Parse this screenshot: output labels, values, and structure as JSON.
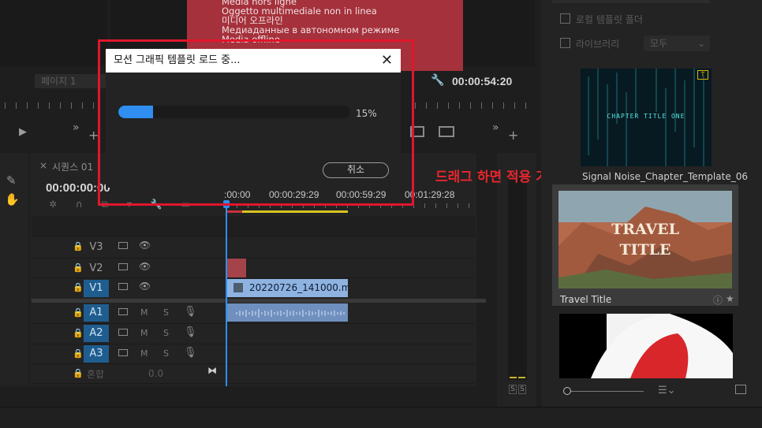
{
  "monitor": {
    "offline_lines": [
      "Média hors ligne",
      "Oggetto multimediale non in linea",
      "미디어 오프라인",
      "Медиаданные в автономном режиме",
      "Media offline"
    ],
    "page_label": "페이지 1",
    "duration_timecode": "00:00:54:20"
  },
  "dialog": {
    "title": "모션 그래픽 템플릿 로드 중...",
    "progress_percent": 15,
    "progress_text": "15%",
    "cancel_label": "취소"
  },
  "annotation": "드래그 하면 적용 가능",
  "timeline": {
    "sequence_tab": "시퀀스 01",
    "timecode": "00:00:00:00",
    "ruler_labels": [
      ":00:00",
      "00:00:29:29",
      "00:00:59:29",
      "00:01:29:28"
    ],
    "tracks": [
      {
        "id": "V3",
        "targeted": false
      },
      {
        "id": "V2",
        "targeted": false
      },
      {
        "id": "V1",
        "targeted": true
      },
      {
        "id": "A1",
        "targeted": true
      },
      {
        "id": "A2",
        "targeted": true
      },
      {
        "id": "A3",
        "targeted": true
      }
    ],
    "mix_label": "혼합",
    "mix_value": "0.0",
    "clip_name": "20220726_141000.m",
    "audio_m": "M",
    "audio_s": "S"
  },
  "meters": {
    "solo_left": "S",
    "solo_right": "S"
  },
  "library": {
    "local_templates": "로컬 템플릿 폴더",
    "libraries": "라이브러리",
    "libraries_select": "모두",
    "templates": [
      {
        "name": "Signal Noise_Chapter_Template_06",
        "thumb_text": "CHAPTER TITLE ONE"
      },
      {
        "name": "Travel Title",
        "thumb_text": "TRAVEL TITLE"
      }
    ]
  }
}
